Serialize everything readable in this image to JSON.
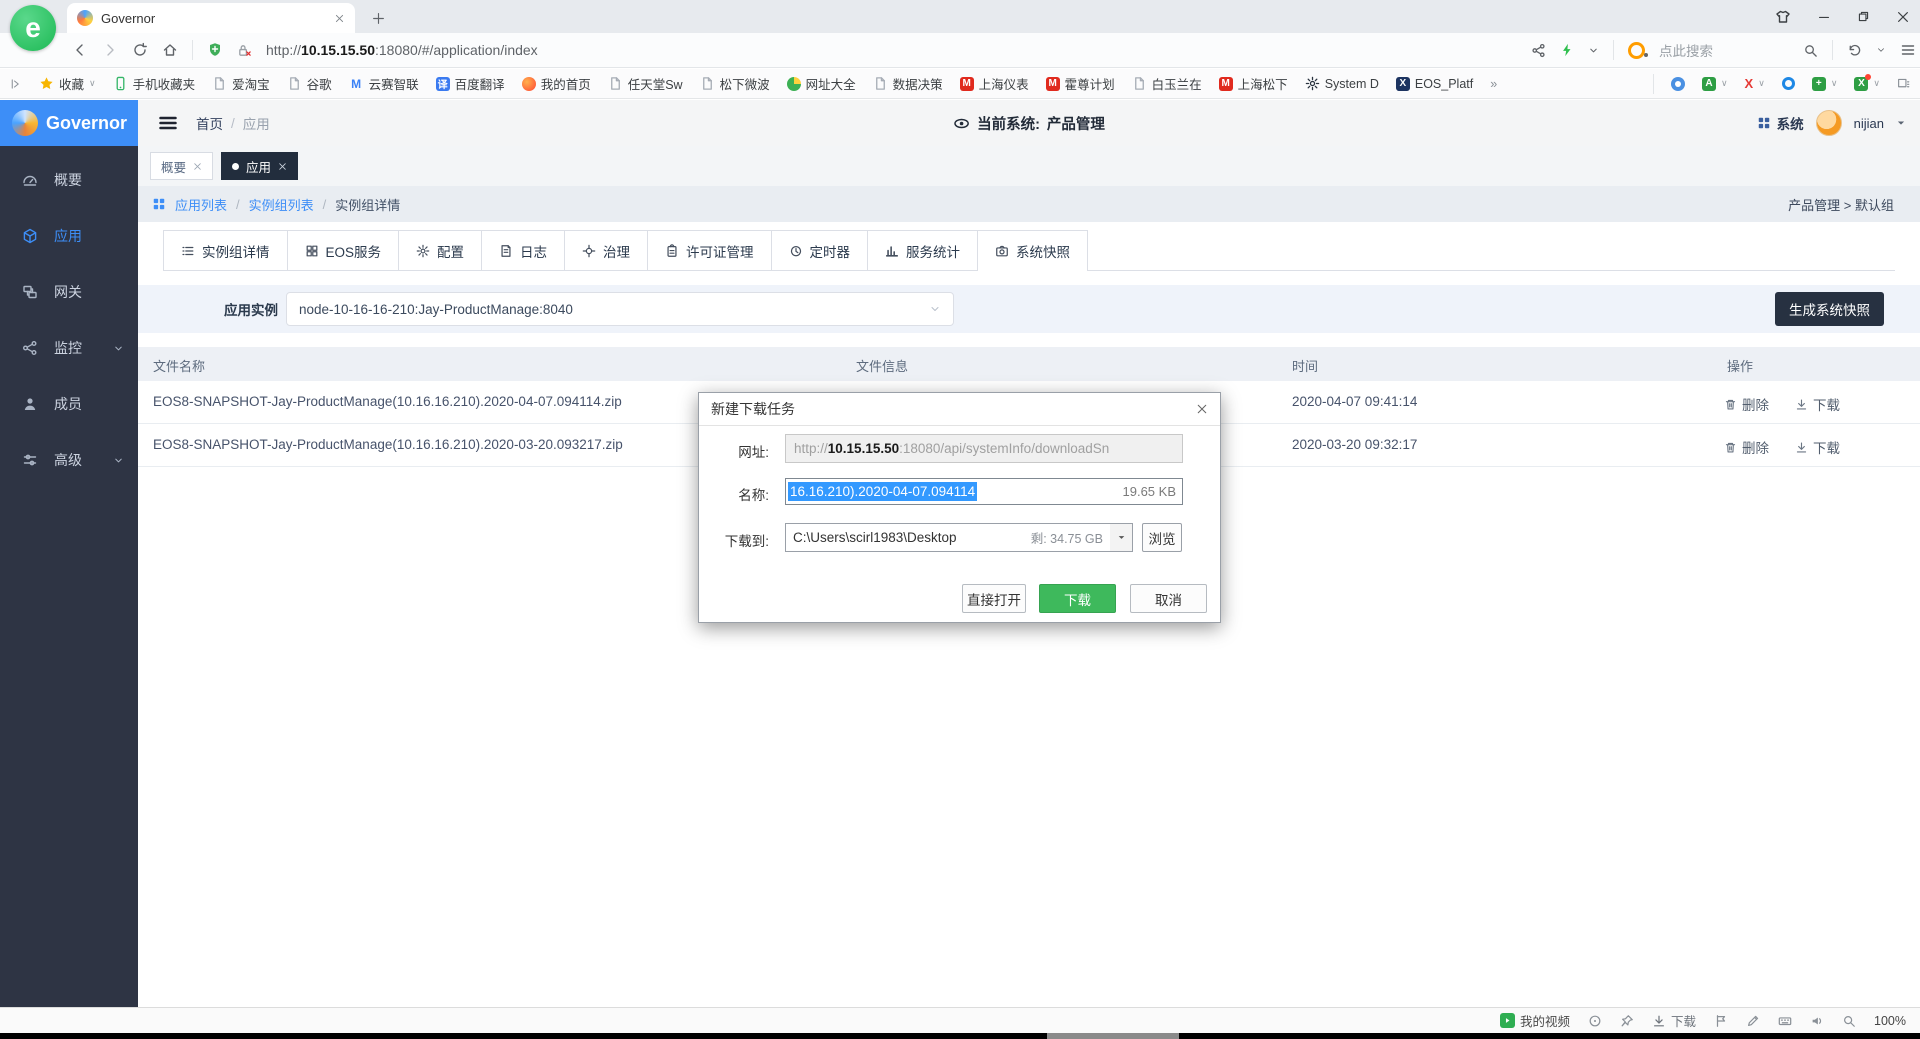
{
  "browser": {
    "tab_title": "Governor",
    "url": {
      "scheme": "http://",
      "host": "10.15.15.50",
      "rest": ":18080/#/application/index"
    },
    "search_placeholder": "点此搜索",
    "bookmarks": [
      {
        "label": "收藏"
      },
      {
        "label": "手机收藏夹"
      },
      {
        "label": "爱淘宝"
      },
      {
        "label": "谷歌"
      },
      {
        "label": "云赛智联"
      },
      {
        "label": "百度翻译"
      },
      {
        "label": "我的首页"
      },
      {
        "label": "任天堂Sw"
      },
      {
        "label": "松下微波"
      },
      {
        "label": "网址大全"
      },
      {
        "label": "数据决策"
      },
      {
        "label": "上海仪表"
      },
      {
        "label": "霍尊计划"
      },
      {
        "label": "白玉兰在"
      },
      {
        "label": "上海松下"
      },
      {
        "label": "System D"
      },
      {
        "label": "EOS_Platf"
      }
    ],
    "icon_glyphs": {
      "e": "e",
      "m": "M",
      "baidu": "译",
      "x": "X",
      "a": "A",
      "plus": "+"
    },
    "overflow_glyph": "»"
  },
  "app": {
    "logo_text": "Governor",
    "top_breadcrumb": {
      "home": "首页",
      "sep": "/",
      "current": "应用"
    },
    "current_system": {
      "label": "当前系统:",
      "value": "产品管理"
    },
    "system_menu": "系统",
    "user_name": "nijian",
    "sidebar": [
      {
        "label": "概要"
      },
      {
        "label": "应用"
      },
      {
        "label": "网关"
      },
      {
        "label": "监控"
      },
      {
        "label": "成员"
      },
      {
        "label": "高级"
      }
    ],
    "page_tabs": [
      {
        "label": "概要"
      },
      {
        "label": "应用"
      }
    ],
    "breadcrumb": {
      "link1": "应用列表",
      "link2": "实例组列表",
      "current": "实例组详情",
      "right": "产品管理 > 默认组"
    },
    "detail_tabs": [
      {
        "label": "实例组详情"
      },
      {
        "label": "EOS服务"
      },
      {
        "label": "配置"
      },
      {
        "label": "日志"
      },
      {
        "label": "治理"
      },
      {
        "label": "许可证管理"
      },
      {
        "label": "定时器"
      },
      {
        "label": "服务统计"
      },
      {
        "label": "系统快照"
      }
    ],
    "instance": {
      "label": "应用实例",
      "value": "node-10-16-16-210:Jay-ProductManage:8040"
    },
    "snapshot_button": "生成系统快照",
    "table": {
      "columns": [
        "文件名称",
        "文件信息",
        "时间",
        "操作"
      ],
      "rows": [
        {
          "name": "EOS8-SNAPSHOT-Jay-ProductManage(10.16.16.210).2020-04-07.094114.zip",
          "time": "2020-04-07 09:41:14",
          "delete": "删除",
          "download": "下载"
        },
        {
          "name": "EOS8-SNAPSHOT-Jay-ProductManage(10.16.16.210).2020-03-20.093217.zip",
          "time": "2020-03-20 09:32:17",
          "delete": "删除",
          "download": "下载"
        }
      ]
    }
  },
  "dialog": {
    "title": "新建下载任务",
    "url_label": "网址:",
    "url": {
      "scheme": "http://",
      "host": "10.15.15.50",
      "rest": ":18080/api/systemInfo/downloadSn"
    },
    "name_label": "名称:",
    "name_selected": "16.16.210).2020-04-07.094114",
    "file_size": "19.65 KB",
    "dest_label": "下载到:",
    "dest_value": "C:\\Users\\scirl1983\\Desktop",
    "free_space": "剩: 34.75 GB",
    "browse_button": "浏览",
    "open_button": "直接打开",
    "download_button": "下载",
    "cancel_button": "取消"
  },
  "statusbar": {
    "my_videos": "我的视频",
    "download": "下载",
    "zoom_level": "100%"
  },
  "colors": {
    "accent_blue": "#3d8ef7",
    "sidebar_dark": "#2e3444",
    "navy_button": "#273141",
    "download_green": "#3eb95c",
    "selection_blue": "#3399ff"
  }
}
